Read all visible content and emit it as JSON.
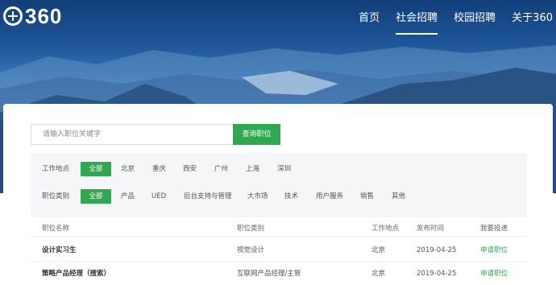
{
  "header": {
    "logo_text": "360",
    "nav": [
      {
        "label": "首页",
        "active": false
      },
      {
        "label": "社会招聘",
        "active": true
      },
      {
        "label": "校园招聘",
        "active": false
      },
      {
        "label": "关于360",
        "active": false
      }
    ]
  },
  "search": {
    "placeholder": "请输入职位关键字",
    "button_label": "查询职位"
  },
  "filters": {
    "location": {
      "label": "工作地点",
      "options": [
        "全部",
        "北京",
        "重庆",
        "西安",
        "广州",
        "上海",
        "深圳"
      ],
      "selected": "全部"
    },
    "category": {
      "label": "职位类别",
      "options": [
        "全部",
        "产品",
        "UED",
        "后台支持与管理",
        "大市场",
        "技术",
        "用户服务",
        "销售",
        "其他"
      ],
      "selected": "全部"
    }
  },
  "table": {
    "headers": [
      "职位名称",
      "职位类别",
      "工作地点",
      "发布时间",
      "我要投递"
    ],
    "rows": [
      {
        "title": "设计实习生",
        "category": "视觉设计",
        "location": "北京",
        "date": "2019-04-25",
        "action": "申请职位"
      },
      {
        "title": "策略产品经理（搜索）",
        "category": "互联网产品经理/主管",
        "location": "北京",
        "date": "2019-04-25",
        "action": "申请职位"
      }
    ]
  },
  "colors": {
    "accent": "#2fa84f",
    "hero_top": "#123e7a"
  }
}
